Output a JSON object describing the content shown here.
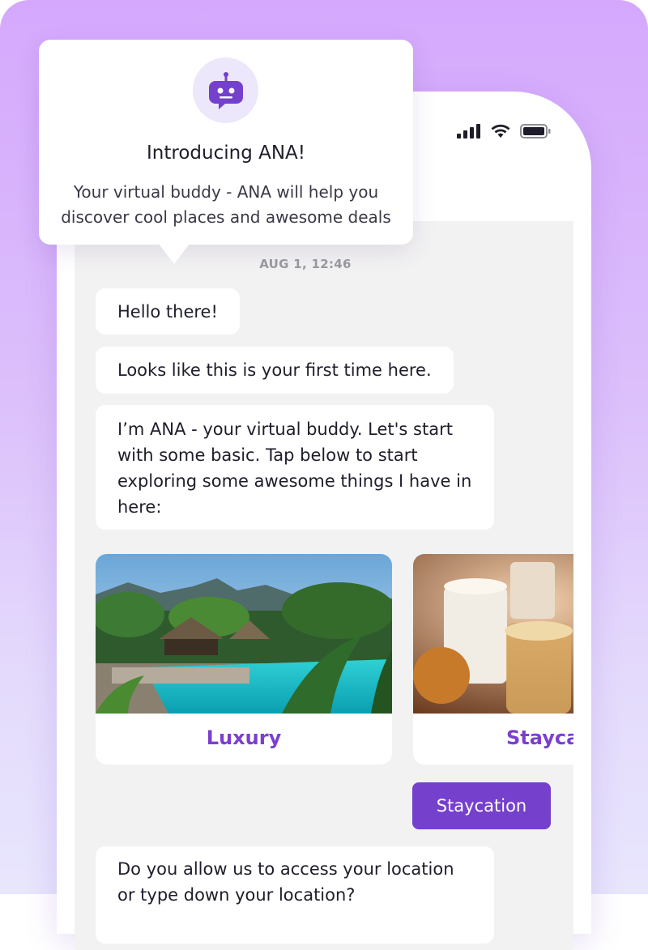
{
  "status_bar": {
    "icons": [
      "signal-icon",
      "wifi-icon",
      "battery-icon"
    ]
  },
  "popup": {
    "icon": "robot-chat-icon",
    "title": "Introducing ANA!",
    "body_line1": "Your virtual buddy - ANA will help you",
    "body_line2": "discover cool places and awesome deals"
  },
  "chat": {
    "timestamp": "AUG 1, 12:46",
    "messages": [
      {
        "text": "Hello there!"
      },
      {
        "text": "Looks like this is your first time here."
      },
      {
        "text": "I’m ANA - your virtual buddy. Let's start with some basic. Tap below to start exploring some awesome things I have in here:"
      },
      {
        "text": "Do you allow us to access your location or type down your location?"
      }
    ],
    "cards": [
      {
        "label": "Luxury",
        "image": "tropical-pool-resort"
      },
      {
        "label": "Staycation",
        "image": "candles-and-tea"
      }
    ],
    "user_reply": "Staycation"
  },
  "colors": {
    "accent": "#7540cc",
    "card_label": "#7b3fd0",
    "background_top": "#d5a8fd",
    "background_bottom": "#e8e6fd"
  }
}
